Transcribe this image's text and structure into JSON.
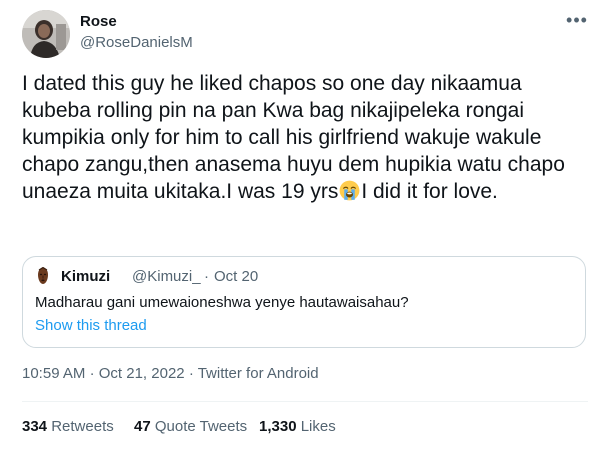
{
  "author": {
    "display_name": "Rose",
    "handle": "@RoseDanielsM",
    "avatar_icon": "profile-photo"
  },
  "more_icon": "more-options-icon",
  "tweet": {
    "text_before_emoji": "I dated this guy he liked chapos so one day nikaamua kubeba rolling pin na pan Kwa bag nikajipeleka rongai kumpikia only for him to call his girlfriend wakuje wakule chapo zangu,then anasema huyu dem hupikia watu chapo unaeza muita ukitaka.I was 19 yrs",
    "emoji": "loudly-crying-face",
    "text_after_emoji": "I did it for love."
  },
  "quoted_tweet": {
    "avatar_icon": "african-mask-avatar",
    "display_name": "Kimuzi",
    "handle": "@Kimuzi_",
    "separator": "·",
    "date": "Oct 20",
    "text": "Madharau gani umewaioneshwa yenye hautawaisahau?",
    "show_thread": "Show this thread"
  },
  "meta": {
    "time": "10:59 AM",
    "sep1": "·",
    "date": "Oct 21, 2022",
    "sep2": "·",
    "source": "Twitter for Android"
  },
  "stats": {
    "retweets_count": "334",
    "retweets_label": "Retweets",
    "quotes_count": "47",
    "quotes_label": "Quote Tweets",
    "likes_count": "1,330",
    "likes_label": "Likes"
  }
}
